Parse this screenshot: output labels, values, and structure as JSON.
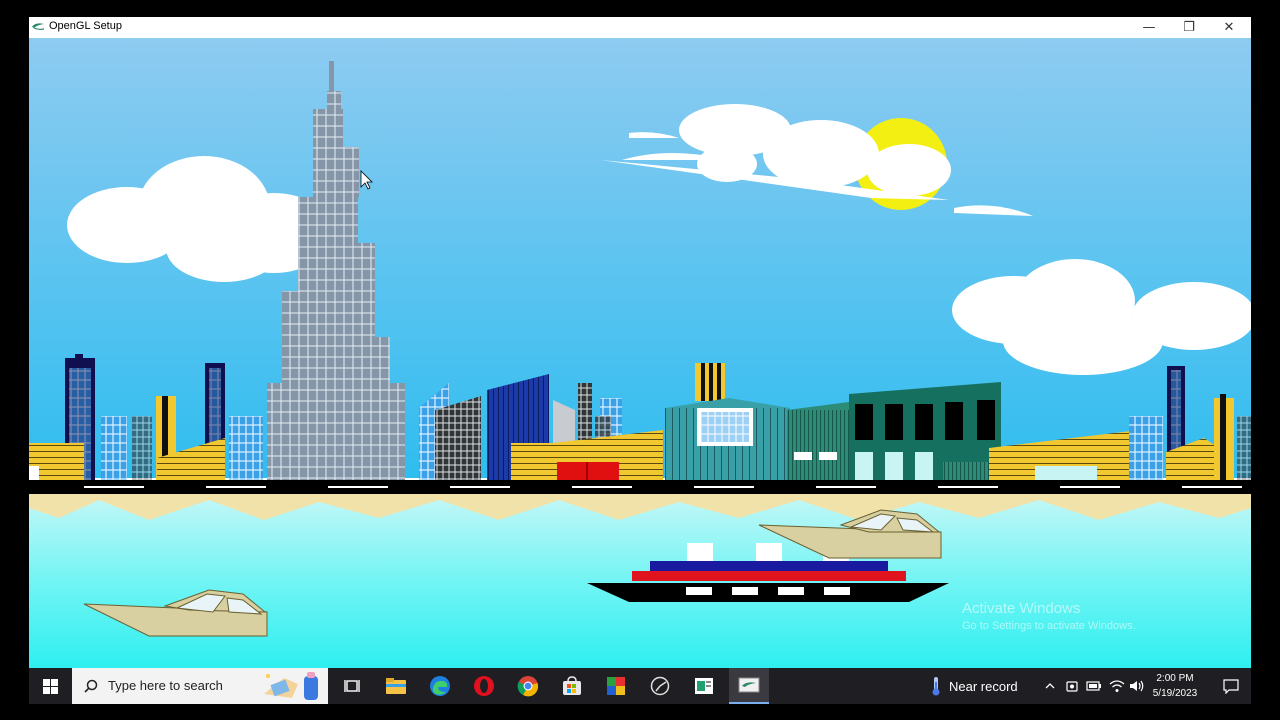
{
  "window": {
    "title": "OpenGL Setup",
    "controls": {
      "minimize": "—",
      "restore": "❐",
      "close": "✕"
    }
  },
  "scene": {
    "colors": {
      "sky_top": "#8ccaf0",
      "sky_bottom": "#31bdef",
      "water": "#55f0f0",
      "sand": "#f0e2a8",
      "road": "#000000",
      "boat": "#d8d0a0",
      "ship_red": "#e0141e",
      "ship_blue": "#1a1aa0",
      "sun": "#f2ee10"
    }
  },
  "watermark": {
    "line1": "Activate Windows",
    "line2": "Go to Settings to activate Windows."
  },
  "taskbar": {
    "search_placeholder": "Type here to search",
    "weather": "Near record",
    "time": "2:00 PM",
    "date": "5/19/2023",
    "icons": [
      "windows-start-icon",
      "search-icon",
      "task-view-icon",
      "file-explorer-icon",
      "edge-icon",
      "opera-icon",
      "chrome-icon",
      "store-icon",
      "app-icon-1",
      "app-icon-2",
      "app-icon-3",
      "opengl-app-icon"
    ]
  }
}
